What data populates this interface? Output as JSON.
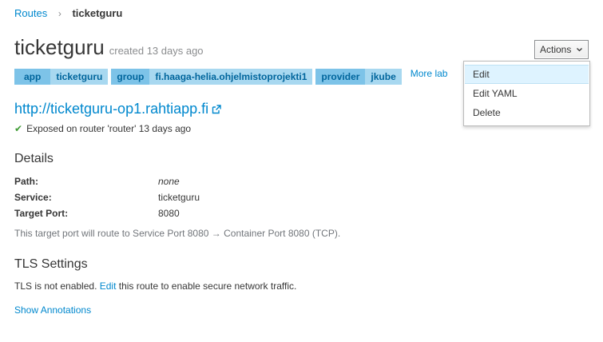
{
  "breadcrumb": {
    "parent": "Routes",
    "separator": "›",
    "current": "ticketguru"
  },
  "header": {
    "title": "ticketguru",
    "created": "created 13 days ago"
  },
  "labels": [
    {
      "key": "app",
      "value": "ticketguru"
    },
    {
      "key": "group",
      "value": "fi.haaga-helia.ohjelmistoprojekti1"
    },
    {
      "key": "provider",
      "value": "jkube"
    }
  ],
  "more_labels": "More lab",
  "actions": {
    "button_label": "Actions",
    "items": [
      "Edit",
      "Edit YAML",
      "Delete"
    ],
    "active_item": "Edit"
  },
  "route": {
    "host": "http://ticketguru-op1.rahtiapp.fi",
    "exposed": "Exposed on router 'router' 13 days ago"
  },
  "details": {
    "heading": "Details",
    "path_label": "Path:",
    "path_value": "none",
    "service_label": "Service:",
    "service_value": "ticketguru",
    "port_label": "Target Port:",
    "port_value": "8080",
    "help_text": "This target port will route to Service Port 8080 → Container Port 8080 (TCP)."
  },
  "tls": {
    "heading": "TLS Settings",
    "text_before": "TLS is not enabled. ",
    "edit_link": "Edit",
    "text_after": " this route to enable secure network traffic."
  },
  "show_annotations": "Show Annotations",
  "colors": {
    "link": "#0088ce",
    "label_key_bg": "#7dc3e8",
    "label_value_bg": "#a8d8f0",
    "success": "#3f9c35"
  },
  "icons": {
    "external": "external-link-icon",
    "check": "check-icon",
    "caret": "caret-down-icon"
  }
}
